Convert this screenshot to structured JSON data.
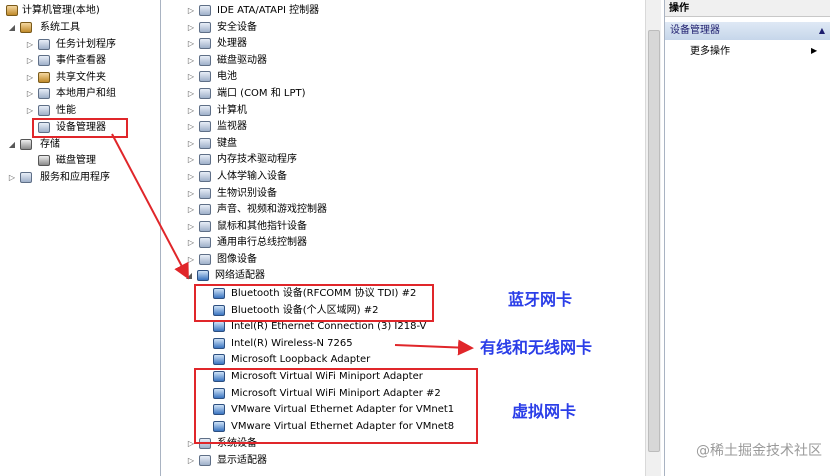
{
  "left_tree": {
    "root": "计算机管理(本地)",
    "system_tools": "系统工具",
    "task_scheduler": "任务计划程序",
    "event_viewer": "事件查看器",
    "shared_folders": "共享文件夹",
    "local_users": "本地用户和组",
    "performance": "性能",
    "device_manager": "设备管理器",
    "storage": "存储",
    "disk_management": "磁盘管理",
    "services_apps": "服务和应用程序"
  },
  "device_tree": {
    "categories_top": [
      "IDE ATA/ATAPI 控制器",
      "安全设备",
      "处理器",
      "磁盘驱动器",
      "电池",
      "端口 (COM 和 LPT)",
      "计算机",
      "监视器",
      "键盘",
      "内存技术驱动程序",
      "人体学输入设备",
      "生物识别设备",
      "声音、视频和游戏控制器",
      "鼠标和其他指针设备",
      "通用串行总线控制器",
      "图像设备"
    ],
    "network_category": "网络适配器",
    "adapters": [
      "Bluetooth 设备(RFCOMM 协议 TDI) #2",
      "Bluetooth 设备(个人区域网) #2",
      "Intel(R) Ethernet Connection (3) I218-V",
      "Intel(R) Wireless-N 7265",
      "Microsoft Loopback Adapter",
      "Microsoft Virtual WiFi Miniport Adapter",
      "Microsoft Virtual WiFi Miniport Adapter #2",
      "VMware Virtual Ethernet Adapter for VMnet1",
      "VMware Virtual Ethernet Adapter for VMnet8"
    ],
    "categories_bottom": [
      "系统设备",
      "显示适配器"
    ]
  },
  "actions": {
    "header": "操作",
    "section": "设备管理器",
    "more": "更多操作"
  },
  "annotations": {
    "bluetooth": "蓝牙网卡",
    "wired_wireless": "有线和无线网卡",
    "virtual": "虚拟网卡"
  },
  "watermark": "@稀土掘金技术社区",
  "colors": {
    "annotation_box": "#e0262a",
    "annotation_text": "#2b3ee8"
  }
}
